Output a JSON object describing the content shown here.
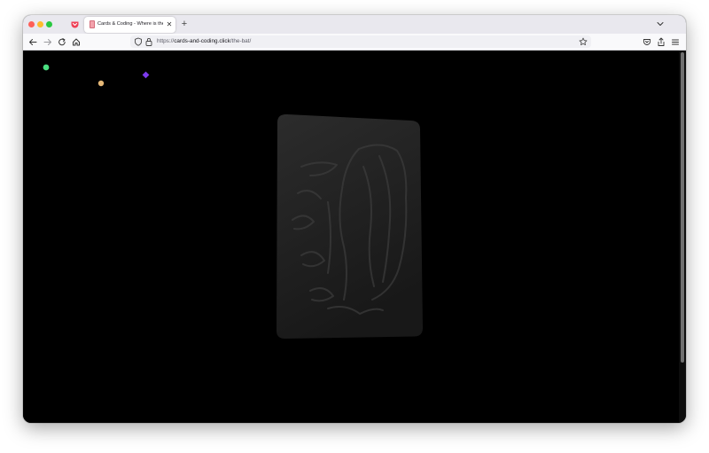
{
  "browser": {
    "tab": {
      "title": "Cards & Coding - Where is the ·",
      "close": "✕"
    },
    "new_tab": "+",
    "url": {
      "prefix": "https://",
      "host": "cards-and-coding.click",
      "path": "/the-bat/"
    }
  },
  "icons": [
    "pocket-icon",
    "close-icon",
    "plus-icon",
    "chevron-down-icon",
    "back-arrow-icon",
    "forward-arrow-icon",
    "reload-icon",
    "home-icon",
    "shield-icon",
    "lock-icon",
    "star-icon",
    "pocket-save-icon",
    "share-icon",
    "menu-icon"
  ],
  "page": {
    "particles": [
      {
        "color": "#4ade80",
        "shape": "circle"
      },
      {
        "color": "#e6b877",
        "shape": "circle"
      },
      {
        "color": "#7c3aed",
        "shape": "diamond"
      }
    ],
    "card": {
      "description_hidden": true,
      "colors": {
        "top": "#2c2c2c",
        "bottom": "#1a1a1a"
      }
    }
  }
}
